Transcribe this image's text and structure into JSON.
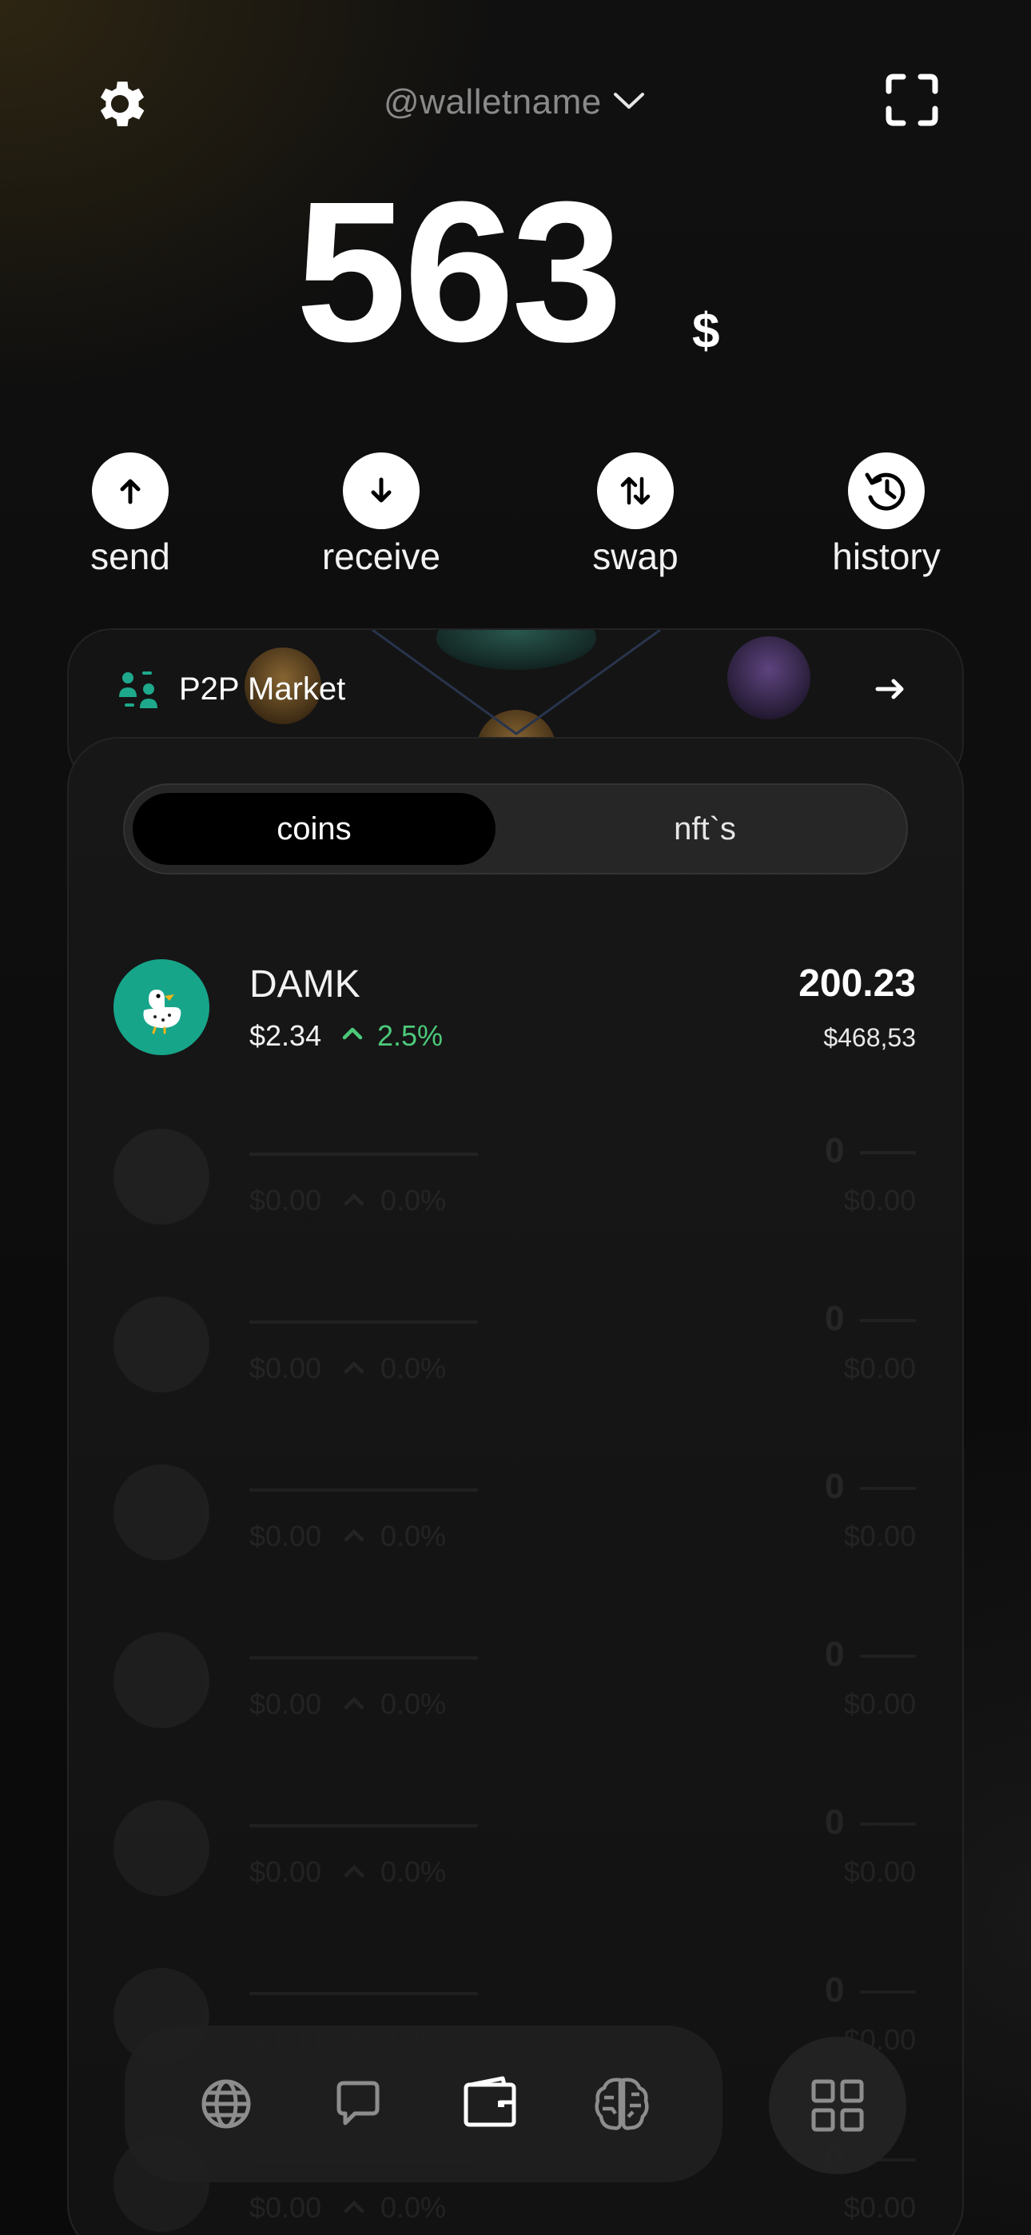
{
  "header": {
    "wallet_name": "@walletname",
    "icons": [
      "gear-icon",
      "chevron-down-icon",
      "scan-icon"
    ]
  },
  "balance": {
    "amount": "563",
    "currency": "$"
  },
  "actions": [
    {
      "label": "send",
      "icon": "arrow-up-icon"
    },
    {
      "label": "receive",
      "icon": "arrow-down-icon"
    },
    {
      "label": "swap",
      "icon": "swap-icon"
    },
    {
      "label": "history",
      "icon": "history-icon"
    }
  ],
  "p2p": {
    "title": "P2P Market",
    "icon": "users-icon"
  },
  "tabs": {
    "active": "coins",
    "inactive": "nft`s"
  },
  "coins": [
    {
      "name": "DAMK",
      "price": "$2.34",
      "change": "2.5%",
      "amount": "200.23",
      "value": "$468,53",
      "logo_color": "#17a58a",
      "change_color": "#4cc97a"
    }
  ],
  "placeholders": [
    {
      "price": "$0.00",
      "change": "0.0%",
      "amount": "0",
      "value": "$0.00"
    },
    {
      "price": "$0.00",
      "change": "0.0%",
      "amount": "0",
      "value": "$0.00"
    },
    {
      "price": "$0.00",
      "change": "0.0%",
      "amount": "0",
      "value": "$0.00"
    },
    {
      "price": "$0.00",
      "change": "0.0%",
      "amount": "0",
      "value": "$0.00"
    },
    {
      "price": "$0.00",
      "change": "0.0%",
      "amount": "0",
      "value": "$0.00"
    },
    {
      "price": "$0.00",
      "change": "0.0%",
      "amount": "0",
      "value": "$0.00"
    },
    {
      "price": "$0.00",
      "change": "0.0%",
      "amount": "0",
      "value": "$0.00"
    }
  ],
  "nav": {
    "items": [
      "globe-icon",
      "chat-icon",
      "wallet-icon",
      "brain-icon"
    ],
    "active": "wallet-icon",
    "apps": "apps-grid-icon"
  }
}
